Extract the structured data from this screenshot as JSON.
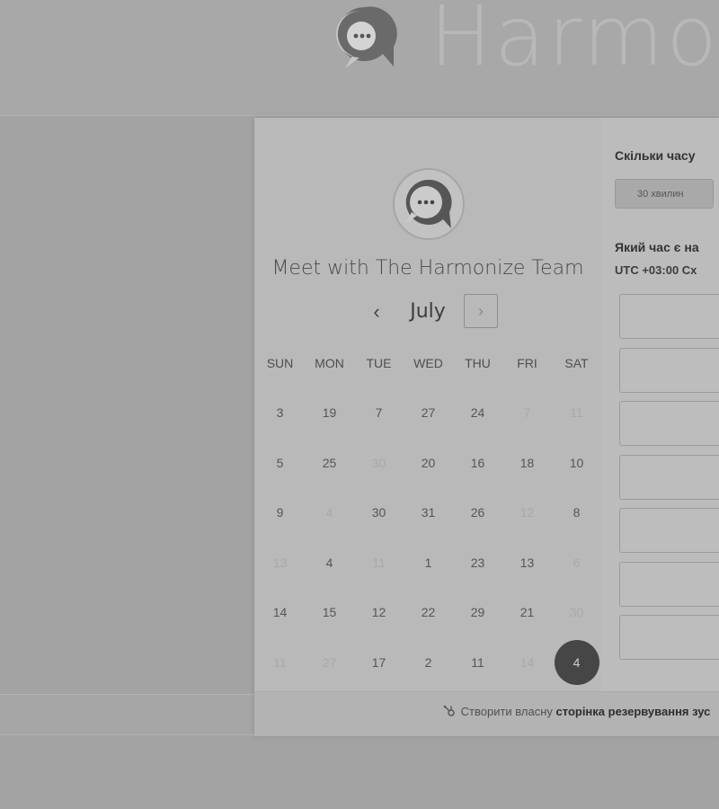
{
  "brand": {
    "name": "Harmon",
    "logo_icon": "chat-bubble-dots-icon"
  },
  "card": {
    "host_name": "Meet with The Harmonize Team",
    "month": "July",
    "prev_icon": "chevron-left-icon",
    "next_icon": "chevron-right-icon",
    "weekdays": [
      "SUN",
      "MON",
      "TUE",
      "WED",
      "THU",
      "FRI",
      "SAT"
    ],
    "weeks": [
      [
        {
          "d": "3",
          "muted": false
        },
        {
          "d": "19",
          "muted": false
        },
        {
          "d": "7",
          "muted": false
        },
        {
          "d": "27",
          "muted": false
        },
        {
          "d": "24",
          "muted": false
        },
        {
          "d": "7",
          "muted": true
        },
        {
          "d": "11",
          "muted": true
        }
      ],
      [
        {
          "d": "5",
          "muted": false
        },
        {
          "d": "25",
          "muted": false
        },
        {
          "d": "30",
          "muted": true
        },
        {
          "d": "20",
          "muted": false
        },
        {
          "d": "16",
          "muted": false
        },
        {
          "d": "18",
          "muted": false
        },
        {
          "d": "10",
          "muted": false
        }
      ],
      [
        {
          "d": "9",
          "muted": false
        },
        {
          "d": "4",
          "muted": true
        },
        {
          "d": "30",
          "muted": false
        },
        {
          "d": "31",
          "muted": false
        },
        {
          "d": "26",
          "muted": false
        },
        {
          "d": "12",
          "muted": true
        },
        {
          "d": "8",
          "muted": false
        }
      ],
      [
        {
          "d": "13",
          "muted": true
        },
        {
          "d": "4",
          "muted": false
        },
        {
          "d": "11",
          "muted": true
        },
        {
          "d": "1",
          "muted": false
        },
        {
          "d": "23",
          "muted": false
        },
        {
          "d": "13",
          "muted": false
        },
        {
          "d": "6",
          "muted": true
        }
      ],
      [
        {
          "d": "14",
          "muted": false
        },
        {
          "d": "15",
          "muted": false
        },
        {
          "d": "12",
          "muted": false
        },
        {
          "d": "22",
          "muted": false
        },
        {
          "d": "29",
          "muted": false
        },
        {
          "d": "21",
          "muted": false
        },
        {
          "d": "30",
          "muted": true
        }
      ],
      [
        {
          "d": "11",
          "muted": true
        },
        {
          "d": "27",
          "muted": true
        },
        {
          "d": "17",
          "muted": false
        },
        {
          "d": "2",
          "muted": false
        },
        {
          "d": "11",
          "muted": false
        },
        {
          "d": "14",
          "muted": true
        },
        {
          "d": "4",
          "muted": false,
          "selected": true
        }
      ]
    ]
  },
  "booking": {
    "duration_question": "Скільки часу",
    "duration_option": "30 хвилин",
    "time_question": "Який час є на",
    "timezone": "UTC +03:00 Сх"
  },
  "footer": {
    "link_prefix": "Створити власну",
    "link_bold": "сторінка резервування зус",
    "icon": "hubspot-sprocket-icon"
  }
}
